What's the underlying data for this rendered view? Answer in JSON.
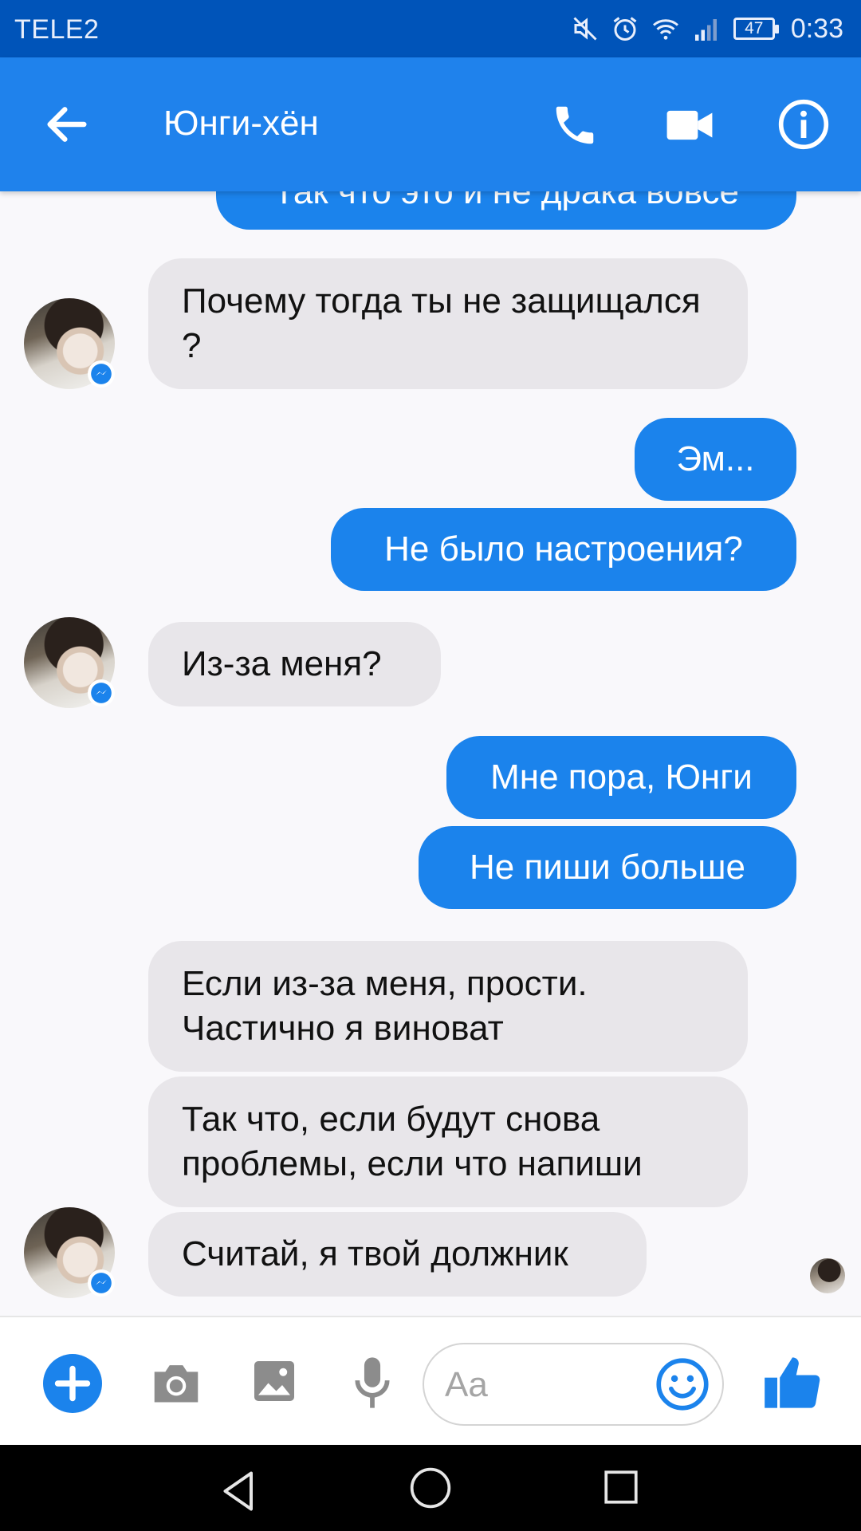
{
  "status_bar": {
    "carrier": "TELE2",
    "battery": "47",
    "time": "0:33"
  },
  "header": {
    "title": "Юнги-хён"
  },
  "messages": [
    {
      "side": "out",
      "text": "Так что это и не драка вовсе"
    },
    {
      "side": "in",
      "text": "Почему тогда ты не защищался ?"
    },
    {
      "side": "out",
      "text": "Эм..."
    },
    {
      "side": "out",
      "text": "Не было настроения?"
    },
    {
      "side": "in",
      "text": "Из-за меня?"
    },
    {
      "side": "out",
      "text": "Мне пора, Юнги"
    },
    {
      "side": "out",
      "text": "Не пиши больше"
    },
    {
      "side": "in",
      "text": "Если  из-за меня, прости. Частично я виноват"
    },
    {
      "side": "in",
      "text": "Так что, если будут снова проблемы, если что напиши"
    },
    {
      "side": "in",
      "text": "Считай, я твой должник"
    }
  ],
  "composer": {
    "placeholder": "Aa"
  },
  "colors": {
    "status_bar": "#0054b9",
    "app_bar": "#1f82ec",
    "outgoing_bubble": "#1b83ec",
    "incoming_bubble": "#e8e6ea"
  }
}
